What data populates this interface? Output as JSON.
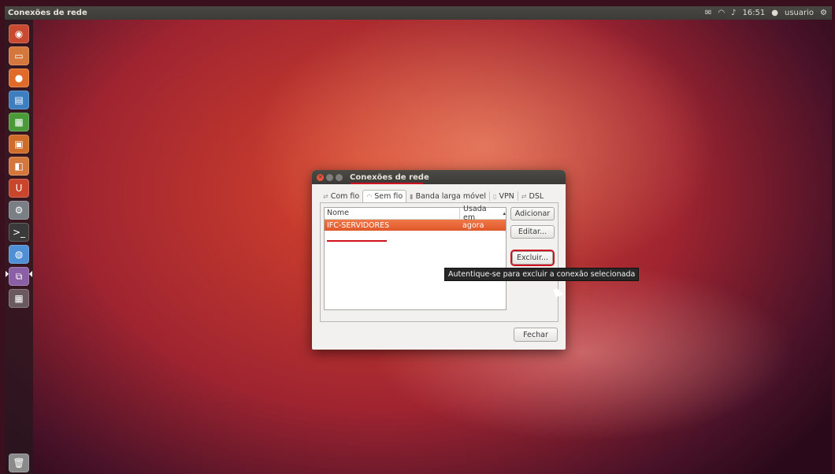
{
  "topbar": {
    "title": "Conexões de rede",
    "mail_icon": "mail-icon",
    "wifi_icon": "wifi-icon",
    "volume_icon": "volume-icon",
    "time": "16:51",
    "user": "usuario",
    "user_icon": "user-icon",
    "gear_icon": "gear-icon"
  },
  "launcher": {
    "items": [
      {
        "name": "dash-home",
        "icon": "ubuntu-logo-icon",
        "color": "#c84a30"
      },
      {
        "name": "files",
        "icon": "folder-icon",
        "color": "#d4773c"
      },
      {
        "name": "firefox",
        "icon": "firefox-icon",
        "color": "#e06a2a"
      },
      {
        "name": "writer",
        "icon": "libreoffice-writer-icon",
        "color": "#3d7ec1"
      },
      {
        "name": "calc",
        "icon": "libreoffice-calc-icon",
        "color": "#4b9a3a"
      },
      {
        "name": "impress",
        "icon": "libreoffice-impress-icon",
        "color": "#d06c2a"
      },
      {
        "name": "software-center",
        "icon": "software-center-icon",
        "color": "#d4773c"
      },
      {
        "name": "ubuntu-one",
        "icon": "ubuntu-one-icon",
        "color": "#c9452c"
      },
      {
        "name": "system-settings",
        "icon": "settings-icon",
        "color": "#7a7f86"
      },
      {
        "name": "terminal",
        "icon": "terminal-icon",
        "color": "#3a3a3a"
      },
      {
        "name": "chromium",
        "icon": "chromium-icon",
        "color": "#4e8fd6"
      },
      {
        "name": "network-connections",
        "icon": "network-icon",
        "color": "#8a5fa6"
      },
      {
        "name": "workspaces",
        "icon": "workspace-switcher-icon",
        "color": "#6a5a60"
      },
      {
        "name": "trash",
        "icon": "trash-icon",
        "color": "#8a8a8a"
      }
    ]
  },
  "dialog": {
    "title": "Conexões de rede",
    "tabs": [
      {
        "label": "Com fio",
        "icon": "wired-icon"
      },
      {
        "label": "Sem fio",
        "icon": "wifi-icon"
      },
      {
        "label": "Banda larga móvel",
        "icon": "mobile-broadband-icon"
      },
      {
        "label": "VPN",
        "icon": "vpn-icon"
      },
      {
        "label": "DSL",
        "icon": "dsl-icon"
      }
    ],
    "active_tab": "Sem fio",
    "columns": {
      "name": "Nome",
      "used": "Usada em"
    },
    "sort_indicator": "▴",
    "rows": [
      {
        "name": "IFC-SERVIDORES",
        "used": "agora"
      }
    ],
    "buttons": {
      "add": "Adicionar",
      "edit": "Editar...",
      "delete": "Excluir...",
      "close": "Fechar"
    },
    "tooltip": "Autentique-se para excluir a conexão selecionada",
    "highlight_color": "#d01020",
    "selection_color": "#e8632f"
  }
}
